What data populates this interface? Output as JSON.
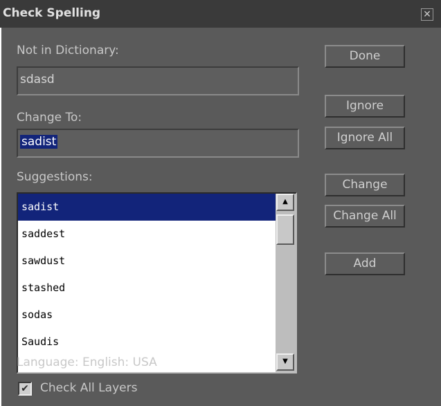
{
  "window": {
    "title": "Check Spelling",
    "close_glyph": "✕"
  },
  "not_in_dictionary": {
    "label": "Not in Dictionary:",
    "value": "sdasd"
  },
  "change_to": {
    "label": "Change To:",
    "value": "sadist"
  },
  "suggestions": {
    "label": "Suggestions:",
    "items": [
      "sadist",
      "saddest",
      "sawdust",
      "stashed",
      "sodas",
      "Saudis"
    ],
    "selected_index": 0
  },
  "buttons": {
    "done": "Done",
    "ignore": "Ignore",
    "ignore_all": "Ignore All",
    "change": "Change",
    "change_all": "Change All",
    "add": "Add"
  },
  "language": "Language: English: USA",
  "check_all_layers": {
    "label": "Check All Layers",
    "checked": true
  },
  "icons": {
    "scroll_up": "▲",
    "scroll_down": "▼",
    "check": "✔"
  },
  "colors": {
    "panel": "#5a5a5a",
    "selection": "#12247a",
    "title_bar": "#3a3a3a"
  }
}
